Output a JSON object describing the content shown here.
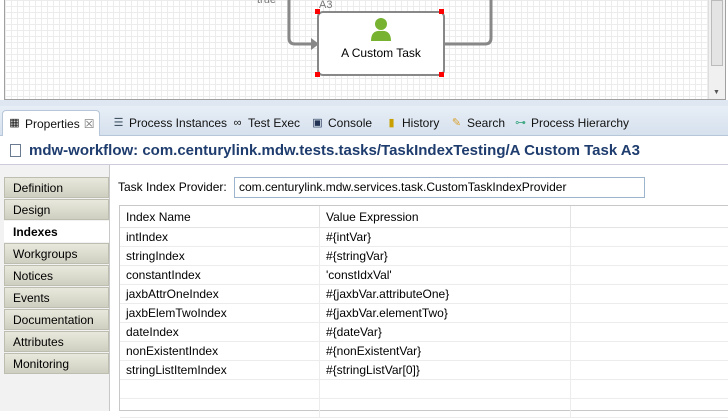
{
  "diagram": {
    "edge_label": "true",
    "activity_id": "A3",
    "activity_name": "A Custom Task",
    "icon": "user-icon"
  },
  "tabs": [
    {
      "label": "Properties",
      "icon": "properties-icon",
      "active": true
    },
    {
      "label": "Process Instances",
      "icon": "list-icon"
    },
    {
      "label": "Test Exec",
      "icon": "glasses-icon"
    },
    {
      "label": "Console",
      "icon": "console-icon"
    },
    {
      "label": "History",
      "icon": "history-icon"
    },
    {
      "label": "Search",
      "icon": "search-icon"
    },
    {
      "label": "Process Hierarchy",
      "icon": "hierarchy-icon"
    }
  ],
  "close_glyph": "☒",
  "panel_title": "mdw-workflow: com.centurylink.mdw.tests.tasks/TaskIndexTesting/A Custom Task A3",
  "nav": [
    "Definition",
    "Design",
    "Indexes",
    "Workgroups",
    "Notices",
    "Events",
    "Documentation",
    "Attributes",
    "Monitoring"
  ],
  "nav_selected": "Indexes",
  "provider": {
    "label": "Task Index Provider:",
    "value": "com.centurylink.mdw.services.task.CustomTaskIndexProvider"
  },
  "table": {
    "headers": [
      "Index Name",
      "Value Expression"
    ],
    "rows": [
      [
        "intIndex",
        "#{intVar}"
      ],
      [
        "stringIndex",
        "#{stringVar}"
      ],
      [
        "constantIndex",
        "'constIdxVal'"
      ],
      [
        "jaxbAttrOneIndex",
        "#{jaxbVar.attributeOne}"
      ],
      [
        "jaxbElemTwoIndex",
        "#{jaxbVar.elementTwo}"
      ],
      [
        "dateIndex",
        "#{dateVar}"
      ],
      [
        "nonExistentIndex",
        "#{nonExistentVar}"
      ],
      [
        "stringListItemIndex",
        "#{stringListVar[0]}"
      ]
    ]
  }
}
